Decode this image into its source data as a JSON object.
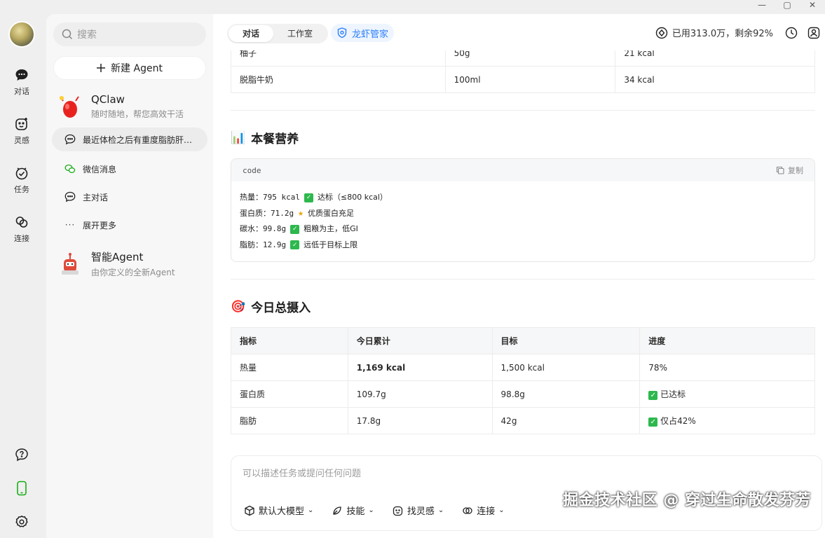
{
  "window": {
    "controls": [
      "—",
      "▢",
      "✕"
    ]
  },
  "rail": {
    "items": [
      {
        "label": "对话",
        "icon": "chat-bubble-icon"
      },
      {
        "label": "灵感",
        "icon": "spark-face-icon"
      },
      {
        "label": "任务",
        "icon": "task-check-icon"
      },
      {
        "label": "连接",
        "icon": "link-icon"
      }
    ]
  },
  "sidebar": {
    "search_placeholder": "搜索",
    "new_agent": "新建 Agent",
    "qclaw": {
      "name": "QClaw",
      "desc": "随时随地，帮您高效干活"
    },
    "items": [
      {
        "label": "最近体检之后有重度脂肪肝…",
        "icon": "chat-bubble-outline-icon"
      },
      {
        "label": "微信消息",
        "icon": "wechat-icon"
      },
      {
        "label": "主对话",
        "icon": "chat-bubble-outline-icon"
      },
      {
        "label": "展开更多",
        "icon": "more-dots-icon"
      }
    ],
    "smart_agent": {
      "name": "智能Agent",
      "desc": "由你定义的全新Agent"
    }
  },
  "topbar": {
    "tabs": [
      "对话",
      "工作室"
    ],
    "active_tab": 0,
    "assistant": "龙虾管家",
    "usage": "已用313.0万，剩余92%"
  },
  "content": {
    "prev_table": {
      "rows": [
        [
          "柚子",
          "50g",
          "21 kcal"
        ],
        [
          "脱脂牛奶",
          "100ml",
          "34 kcal"
        ]
      ]
    },
    "meal_title": "本餐营养",
    "meal_emoji": "📊",
    "code": {
      "lang": "code",
      "copy": "复制",
      "lines": [
        {
          "text": "热量：795 kcal",
          "mark": "check",
          "note": "达标（≤800 kcal）"
        },
        {
          "text": "蛋白质：71.2g",
          "mark": "star",
          "note": "优质蛋白充足"
        },
        {
          "text": "碳水：99.8g",
          "mark": "check",
          "note": "粗粮为主，低GI"
        },
        {
          "text": "脂肪：12.9g",
          "mark": "check",
          "note": "远低于目标上限"
        }
      ]
    },
    "daily_title": "今日总摄入",
    "daily_emoji": "🎯",
    "daily_table": {
      "headers": [
        "指标",
        "今日累计",
        "目标",
        "进度"
      ],
      "rows": [
        {
          "c1": "热量",
          "c2": "1,169 kcal",
          "c3": "1,500 kcal",
          "c4": "78%",
          "check": false
        },
        {
          "c1": "蛋白质",
          "c2": "109.7g",
          "c3": "98.8g",
          "c4": "已达标",
          "check": true
        },
        {
          "c1": "脂肪",
          "c2": "17.8g",
          "c3": "42g",
          "c4": "仅占42%",
          "check": true
        }
      ]
    }
  },
  "composer": {
    "placeholder": "可以描述任务或提问任何问题",
    "tools": [
      "默认大模型",
      "技能",
      "找灵感",
      "连接"
    ]
  },
  "watermark": "掘金技术社区 @ 穿过生命散发芬芳",
  "colors": {
    "accent": "#2d7ff9",
    "check": "#2db84d",
    "wechat": "#1aad19"
  }
}
